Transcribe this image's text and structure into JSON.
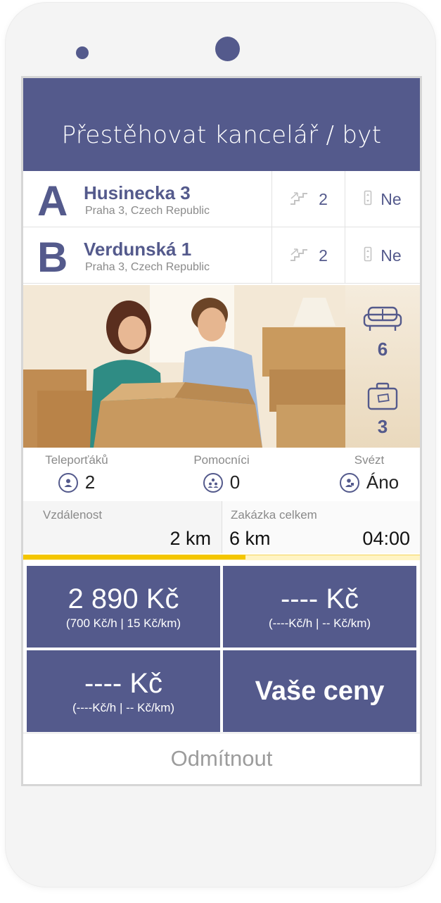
{
  "header": {
    "title": "Přestěhovat kancelář / byt"
  },
  "addresses": [
    {
      "letter": "A",
      "street": "Husinecka 3",
      "city": "Praha 3, Czech Republic",
      "floor": "2",
      "lift": "Ne"
    },
    {
      "letter": "B",
      "street": "Verdunská 1",
      "city": "Praha 3, Czech Republic",
      "floor": "2",
      "lift": "Ne"
    }
  ],
  "items": {
    "furniture_count": "6",
    "luggage_count": "3"
  },
  "stats": {
    "movers": {
      "label": "Teleporťáků",
      "value": "2"
    },
    "helpers": {
      "label": "Pomocníci",
      "value": "0"
    },
    "ride": {
      "label": "Svézt",
      "value": "Áno"
    }
  },
  "distance": {
    "label": "Vzdálenost",
    "value": "2 km",
    "total_label": "Zakázka celkem",
    "total_distance": "6 km",
    "total_time": "04:00",
    "progress_fraction": 0.56
  },
  "prices": [
    {
      "amount": "2 890 Kč",
      "rate": "(700 Kč/h | 15 Kč/km)"
    },
    {
      "amount": "---- Kč",
      "rate": "(----Kč/h | -- Kč/km)"
    },
    {
      "amount": "---- Kč",
      "rate": "(----Kč/h | -- Kč/km)"
    }
  ],
  "your_prices_label": "Vaše ceny",
  "reject_label": "Odmítnout",
  "colors": {
    "brand": "#545a8c",
    "progress": "#f4c600",
    "muted_text": "#8a8a8a"
  }
}
